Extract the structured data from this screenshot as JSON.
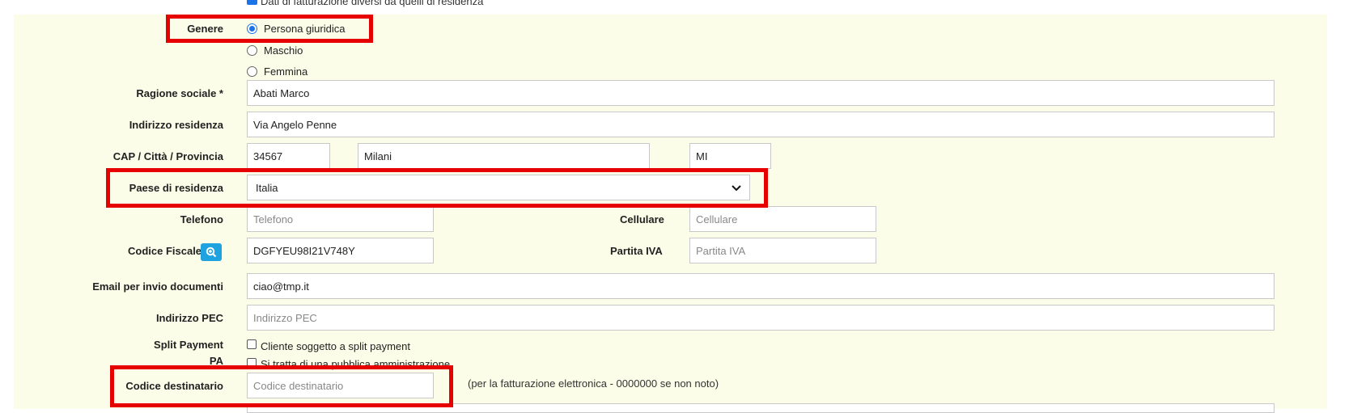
{
  "top": {
    "billing_checkbox_label": "Dati di fatturazione diversi da quelli di residenza",
    "billing_checked": true
  },
  "genere": {
    "label": "Genere",
    "options": [
      {
        "label": "Persona giuridica",
        "selected": true
      },
      {
        "label": "Maschio",
        "selected": false
      },
      {
        "label": "Femmina",
        "selected": false
      }
    ]
  },
  "ragione_sociale": {
    "label": "Ragione sociale *",
    "value": "Abati Marco"
  },
  "indirizzo": {
    "label": "Indirizzo residenza",
    "value": "Via Angelo Penne"
  },
  "cap_citta": {
    "label": "CAP / Città / Provincia",
    "cap": "34567",
    "citta": "Milani",
    "provincia": "MI"
  },
  "paese": {
    "label": "Paese di residenza",
    "value": "Italia"
  },
  "telefono": {
    "label": "Telefono",
    "placeholder": "Telefono"
  },
  "cellulare": {
    "label": "Cellulare",
    "placeholder": "Cellulare"
  },
  "codice_fiscale": {
    "label": "Codice Fiscale",
    "value": "DGFYEU98I21V748Y",
    "icon": "search-zoom-icon"
  },
  "partita_iva": {
    "label": "Partita IVA",
    "placeholder": "Partita IVA"
  },
  "email": {
    "label": "Email per invio documenti",
    "value": "ciao@tmp.it"
  },
  "pec": {
    "label": "Indirizzo PEC",
    "placeholder": "Indirizzo PEC"
  },
  "split": {
    "label": "Split Payment",
    "checkbox_label": "Cliente soggetto a split payment",
    "checked": false
  },
  "pa": {
    "label": "PA",
    "checkbox_label": "Si tratta di una pubblica amministrazione",
    "checked": false
  },
  "codice_destinatario": {
    "label": "Codice destinatario",
    "placeholder": "Codice destinatario",
    "note": "(per la fatturazione elettronica - 0000000 se non noto)"
  },
  "colors": {
    "panel": "#fcfde8",
    "highlight": "#e60000",
    "accent": "#1a73e8",
    "search_button": "#1fa3e0"
  }
}
